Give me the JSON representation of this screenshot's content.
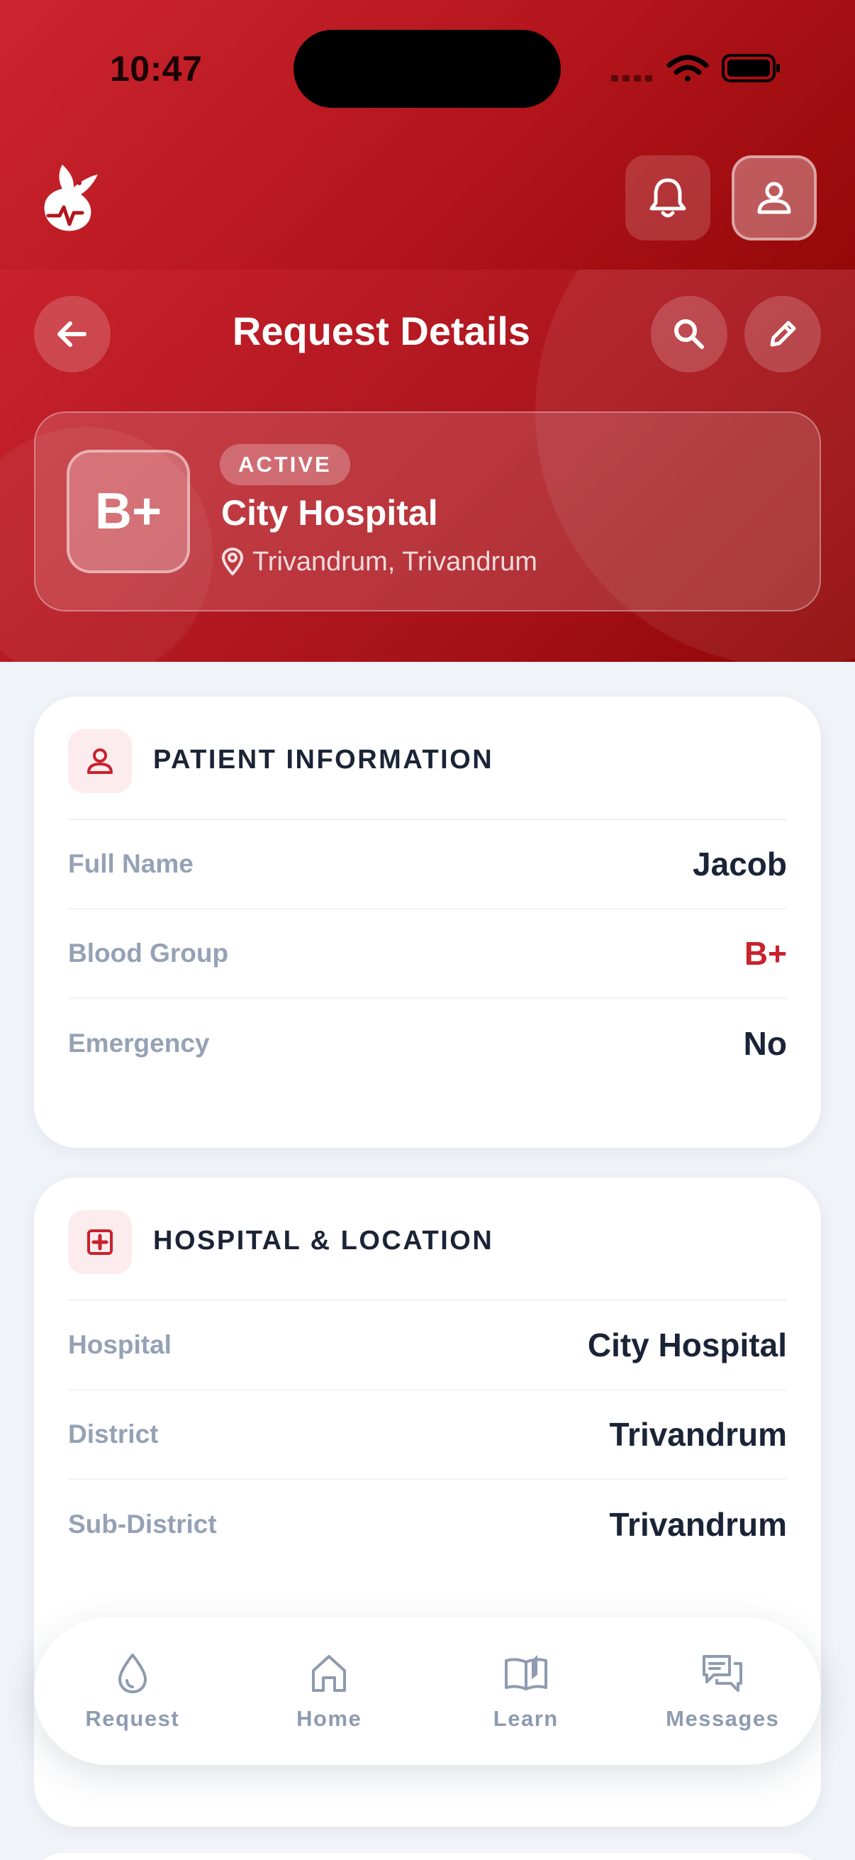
{
  "status_bar": {
    "time": "10:47"
  },
  "header": {
    "logo_icon": "dove-blood-drop-logo-icon",
    "notifications_icon": "bell-icon",
    "profile_icon": "user-icon"
  },
  "hero": {
    "back_icon": "arrow-left-icon",
    "title": "Request Details",
    "search_icon": "search-icon",
    "edit_icon": "pencil-icon",
    "summary": {
      "blood_group": "B+",
      "status": "ACTIVE",
      "hospital": "City Hospital",
      "location": "Trivandrum, Trivandrum"
    }
  },
  "patient_section": {
    "title": "PATIENT INFORMATION",
    "icon": "user-icon",
    "rows": [
      {
        "label": "Full Name",
        "value": "Jacob"
      },
      {
        "label": "Blood Group",
        "value": "B+"
      },
      {
        "label": "Emergency",
        "value": "No"
      }
    ]
  },
  "hospital_section": {
    "title": "HOSPITAL & LOCATION",
    "icon": "hospital-cross-icon",
    "rows": [
      {
        "label": "Hospital",
        "value": "City Hospital"
      },
      {
        "label": "District",
        "value": "Trivandrum"
      },
      {
        "label": "Sub-District",
        "value": "Trivandrum"
      }
    ]
  },
  "bottom_nav": {
    "items": [
      {
        "label": "Request",
        "icon": "drop-icon"
      },
      {
        "label": "Home",
        "icon": "home-icon"
      },
      {
        "label": "Learn",
        "icon": "book-icon"
      },
      {
        "label": "Messages",
        "icon": "chat-icon"
      }
    ]
  },
  "colors": {
    "primary_red": "#c9222c",
    "dark_red": "#950808",
    "text_dark": "#1b2437",
    "text_muted": "#95a1b5",
    "background": "#f0f3f8"
  }
}
